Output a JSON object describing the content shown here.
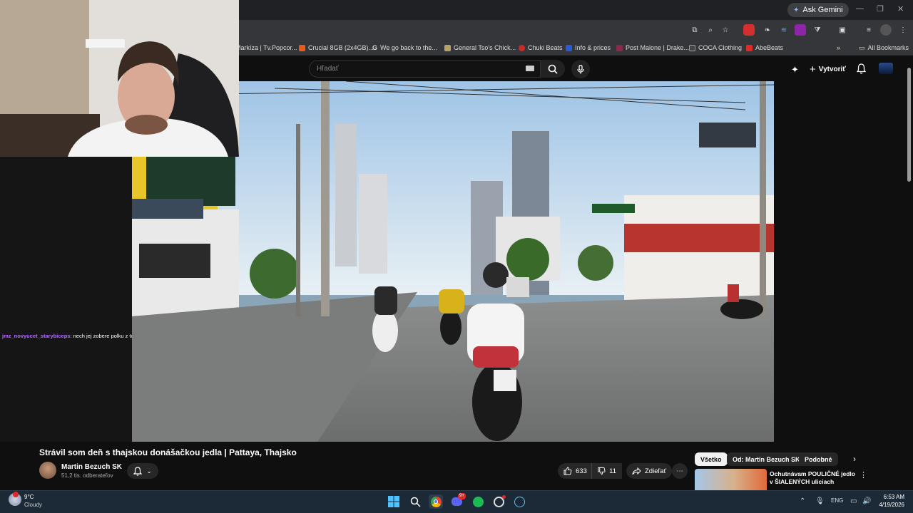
{
  "browser": {
    "ask_gemini": "Ask Gemini",
    "bookmarks": [
      {
        "label": "Markíza | Tv.Popcor...",
        "color": "#3a78c8"
      },
      {
        "label": "Crucial 8GB (2x4GB)...",
        "color": "#e65a1e"
      },
      {
        "label": "We go back to the...",
        "color": "#ffffff"
      },
      {
        "label": "General Tso's Chick...",
        "color": "#b8a26a"
      },
      {
        "label": "Chuki Beats",
        "color": "#cc2a2a"
      },
      {
        "label": "Info & prices",
        "color": "#2a5bd7"
      },
      {
        "label": "Post Malone | Drake...",
        "color": "#8a2a4a"
      },
      {
        "label": "COCA Clothing",
        "color": "#444444"
      },
      {
        "label": "AbeBeats",
        "color": "#e02a2a"
      }
    ],
    "all_bookmarks": "All Bookmarks"
  },
  "youtube": {
    "search_placeholder": "Hľadať",
    "create_label": "Vytvoriť"
  },
  "chat": {
    "user": "jmz_novyucet_starybiceps",
    "message": ": nech jej zobere polku z toho sak maká s nou"
  },
  "video": {
    "title": "Strávil som deň s thajskou donášačkou jedla | Pattaya, Thajsko",
    "channel": "Martin Bezuch SK",
    "subscribers": "51,2 tis. odberateľov",
    "likes": "633",
    "dislikes": "11",
    "share_label": "Zdieľať"
  },
  "recommendations": {
    "chips": [
      "Všetko",
      "Od: Martin Bezuch SK",
      "Podobné"
    ],
    "first_title": "Ochutnávam POULIČNÉ jedlo v ŠIALENÝCH uliciach Bangkok..."
  },
  "taskbar": {
    "weather_temp": "9°C",
    "weather_desc": "Cloudy",
    "language": "ENG",
    "time": "6:53 AM",
    "date": "4/19/2026",
    "discord_badge": "9+"
  },
  "colors": {
    "youtube_bg": "#0f0f0f",
    "taskbar_bg": "#1c2a38",
    "chat_user": "#b26bff"
  }
}
